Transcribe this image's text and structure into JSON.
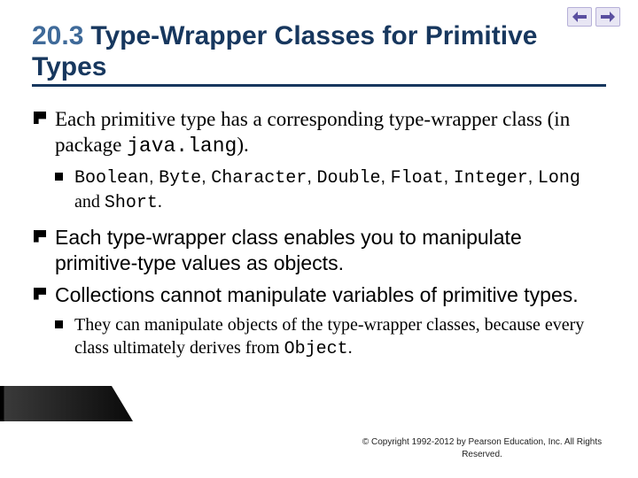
{
  "header": {
    "section_number": "20.3",
    "title_rest": "Type-Wrapper Classes for Primitive Types"
  },
  "nav": {
    "prev_name": "prev-arrow",
    "next_name": "next-arrow"
  },
  "bullets": [
    {
      "pre": "Each primitive type has a corresponding ",
      "term": "type-wrapper class",
      "mid": " (in package ",
      "code": "java.lang",
      "post": ").",
      "sub": [
        {
          "codes": [
            "Boolean",
            "Byte",
            "Character",
            "Double",
            "Float",
            "Integer",
            "Long"
          ],
          "joiner": ", ",
          "and_word": " and ",
          "last_code": "Short",
          "tail": "."
        }
      ]
    },
    {
      "text": "Each type-wrapper class enables you to manipulate primitive-type values as objects."
    },
    {
      "text": "Collections cannot manipulate variables of primitive types.",
      "sub": [
        {
          "plain_pre": "They can manipulate objects of the type-wrapper classes, because every class ultimately derives from ",
          "last_code": "Object",
          "tail": "."
        }
      ]
    }
  ],
  "footer": {
    "copyright": "© Copyright 1992-2012 by Pearson Education, Inc. All Rights Reserved."
  }
}
